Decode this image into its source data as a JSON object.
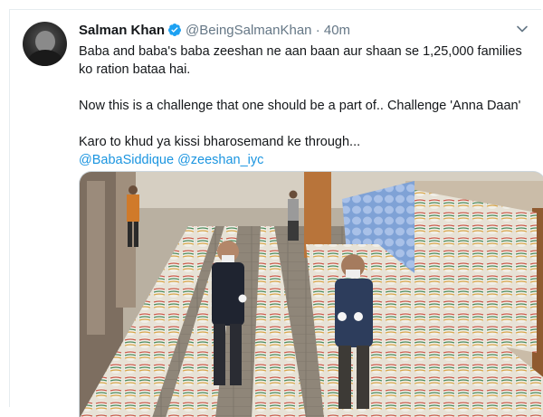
{
  "tweet": {
    "author_name": "Salman Khan",
    "verified": true,
    "handle": "@BeingSalmanKhan",
    "separator": "·",
    "time": "40m",
    "lines": [
      "Baba and baba's baba zeeshan ne aan baan aur shaan se 1,25,000 families ko ration bataa hai.",
      "Now this is a challenge that one should be a part of.. Challenge 'Anna Daan'",
      "Karo to khud ya kissi bharosemand ke through..."
    ],
    "mentions": [
      "@BabaSiddique",
      "@zeeshan_iyc"
    ]
  },
  "icons": {
    "verified": "verified-badge-icon",
    "more": "chevron-down-icon"
  },
  "colors": {
    "link": "#1b95e0",
    "verified": "#1da1f2",
    "muted": "#657786"
  }
}
